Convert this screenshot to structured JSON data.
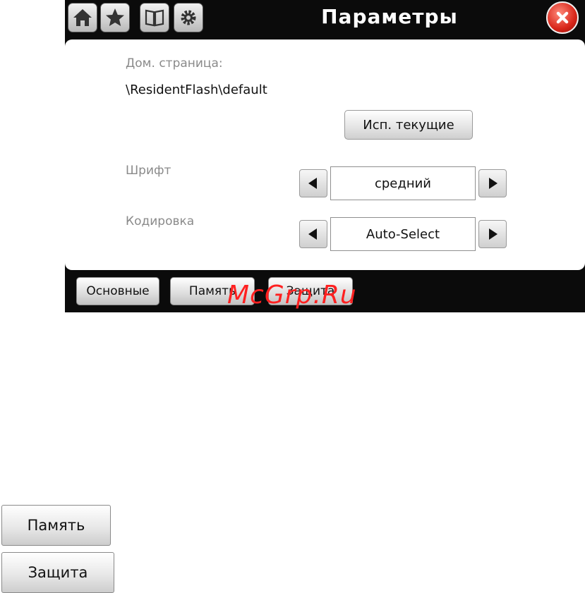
{
  "titlebar": {
    "title": "Параметры",
    "icons": [
      "home-icon",
      "star-icon",
      "book-icon",
      "gear-icon",
      "close-icon"
    ]
  },
  "settings": {
    "homepage_label": "Дом. страница:",
    "homepage_value": "\\ResidentFlash\\default",
    "use_current_label": "Исп. текущие",
    "font_label": "Шрифт",
    "font_value": "средний",
    "encoding_label": "Кодировка",
    "encoding_value": "Auto-Select"
  },
  "tabs": {
    "main": "Основные",
    "memory": "Память",
    "security": "Защита"
  },
  "watermark": "McGrp.Ru",
  "legend_buttons": {
    "memory": "Память",
    "security": "Защита"
  },
  "colors": {
    "close_red": "#d8261a",
    "frame_black": "#0b0b0b",
    "watermark_red": "#ff2020"
  }
}
